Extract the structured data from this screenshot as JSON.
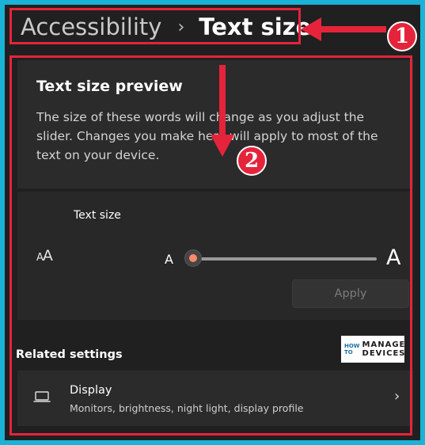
{
  "breadcrumb": {
    "parent": "Accessibility",
    "separator": "›",
    "current": "Text size"
  },
  "preview": {
    "title": "Text size preview",
    "description": "The size of these words will change as you adjust the slider. Changes you make here will apply to most of the text on your device."
  },
  "text_size": {
    "label": "Text size",
    "icon": "font-size-icon",
    "slider_min_label": "A",
    "slider_max_label": "A",
    "slider_value_fraction": 0.0,
    "apply_label": "Apply"
  },
  "related": {
    "heading": "Related settings",
    "items": [
      {
        "icon": "laptop-icon",
        "title": "Display",
        "subtitle": "Monitors, brightness, night light, display profile"
      }
    ]
  },
  "watermark": {
    "line1": "HOW TO",
    "line2": "MANAGE DEVICES"
  },
  "annotations": {
    "badge1": "1",
    "badge2": "2",
    "color": "#e5243b"
  },
  "colors": {
    "accent": "#ff8a6a",
    "frame": "#1ab2d6",
    "background": "#202020"
  }
}
